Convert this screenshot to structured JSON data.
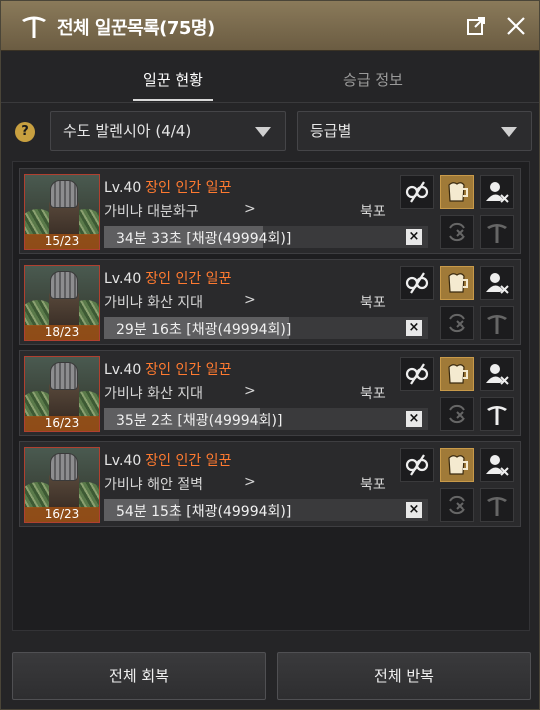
{
  "title": "전체 일꾼목록(75명)",
  "tabs": [
    {
      "label": "일꾼 현황",
      "active": true
    },
    {
      "label": "승급 정보",
      "active": false
    }
  ],
  "help_label": "?",
  "filters": {
    "region": "수도 발렌시아 (4/4)",
    "sort": "등급별"
  },
  "workers": [
    {
      "level": "Lv.40",
      "grade": "장인 인간 일꾼",
      "location": "가비냐 대분화구",
      "arrow": ">",
      "direction": "북포",
      "stamina": "15/23",
      "timer": "34분 33초 [채광(49994회)]",
      "progress": 0.49,
      "close_label": "×"
    },
    {
      "level": "Lv.40",
      "grade": "장인 인간 일꾼",
      "location": "가비냐 화산 지대",
      "arrow": ">",
      "direction": "북포",
      "stamina": "18/23",
      "timer": "29분 16초 [채광(49994회)]",
      "progress": 0.57,
      "close_label": "×"
    },
    {
      "level": "Lv.40",
      "grade": "장인 인간 일꾼",
      "location": "가비냐 화산 지대",
      "arrow": ">",
      "direction": "북포",
      "stamina": "16/23",
      "timer": "35분 2초 [채광(49994회)]",
      "progress": 0.48,
      "close_label": "×"
    },
    {
      "level": "Lv.40",
      "grade": "장인 인간 일꾼",
      "location": "가비냐 해안 절벽",
      "arrow": ">",
      "direction": "북포",
      "stamina": "16/23",
      "timer": "54분 15초 [채광(49994회)]",
      "progress": 0.23,
      "close_label": "×"
    }
  ],
  "buttons": {
    "recover_all": "전체 회복",
    "repeat_all": "전체 반복"
  },
  "colors": {
    "grade_text": "#ff7a30",
    "gold_button": "#a07a38",
    "title_bar": "#8a7a5a"
  }
}
